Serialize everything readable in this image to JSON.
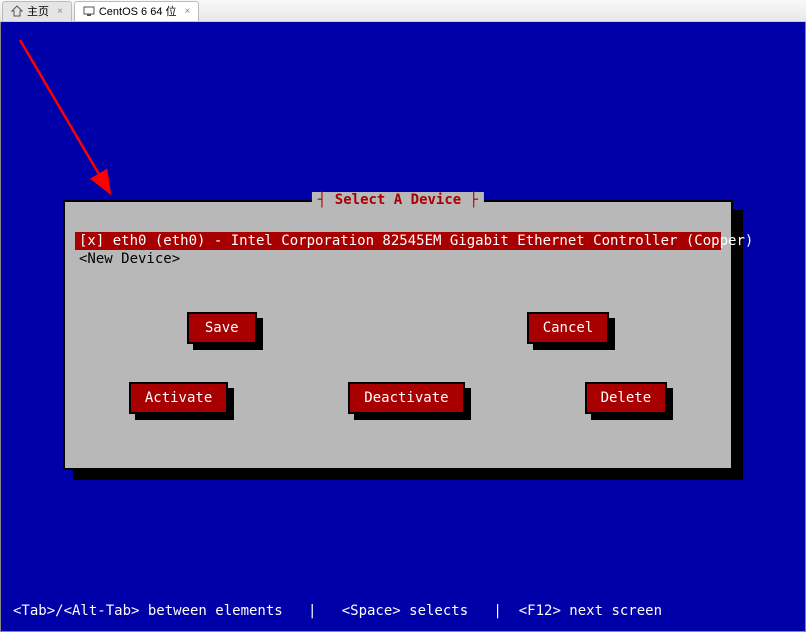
{
  "tabs": {
    "home": "主页",
    "vm": "CentOS 6 64 位"
  },
  "dialog": {
    "title": "┤ Select A Device ├",
    "selected_device": "[x] eth0 (eth0) - Intel Corporation 82545EM Gigabit Ethernet Controller (Copper)",
    "new_device": "<New Device>"
  },
  "buttons": {
    "save": "Save",
    "cancel": "Cancel",
    "activate": "Activate",
    "deactivate": "Deactivate",
    "delete": "Delete"
  },
  "footer": "<Tab>/<Alt-Tab> between elements   |   <Space> selects   |  <F12> next screen"
}
